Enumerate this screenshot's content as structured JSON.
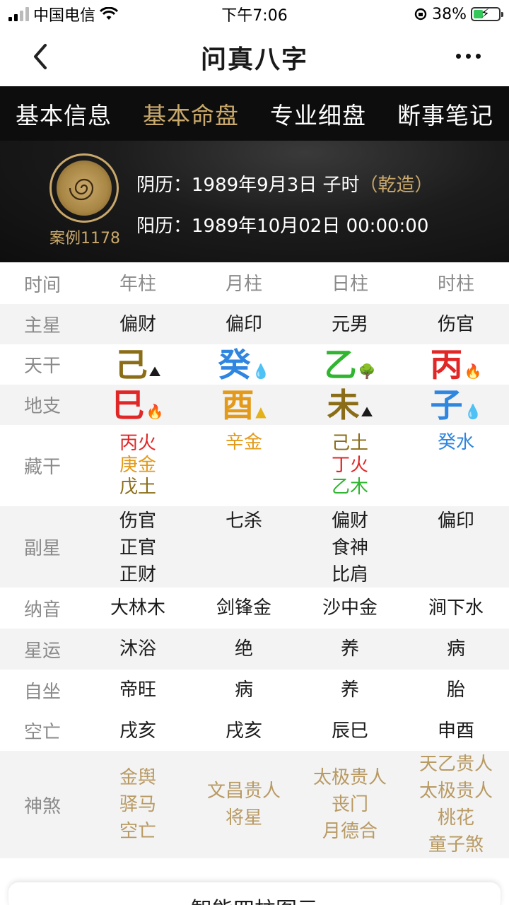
{
  "status": {
    "carrier": "中国电信",
    "time": "下午7:06",
    "battery": "38%",
    "battery_level": 0.38
  },
  "nav": {
    "title": "问真八字"
  },
  "tabs": [
    "基本信息",
    "基本命盘",
    "专业细盘",
    "断事笔记"
  ],
  "active_tab": 1,
  "profile": {
    "case": "案例1178",
    "lunar_label": "阴历：1989年9月3日 子时",
    "lunar_tag": "（乾造）",
    "solar_label": "阳历：1989年10月02日 00:00:00"
  },
  "table": {
    "header": [
      "时间",
      "年柱",
      "月柱",
      "日柱",
      "时柱"
    ],
    "zhuxing": {
      "label": "主星",
      "cells": [
        "偏财",
        "偏印",
        "元男",
        "伤官"
      ]
    },
    "tiangan": {
      "label": "天干",
      "chars": [
        "己",
        "癸",
        "乙",
        "丙"
      ],
      "colors": [
        "#8b6d17",
        "#2f86e0",
        "#2fb52f",
        "#e02626"
      ],
      "icons": [
        "earth-icon",
        "water-icon",
        "wood-icon",
        "fire-icon"
      ]
    },
    "dizhi": {
      "label": "地支",
      "chars": [
        "巳",
        "酉",
        "未",
        "子"
      ],
      "colors": [
        "#e02626",
        "#e39a1a",
        "#8b6d17",
        "#2f86e0"
      ],
      "icons": [
        "fire-icon",
        "metal-icon",
        "earth-icon",
        "water-icon"
      ]
    },
    "canggan": {
      "label": "藏干",
      "cells": [
        [
          {
            "t": "丙火",
            "c": "#e02626"
          },
          {
            "t": "庚金",
            "c": "#e39a1a"
          },
          {
            "t": "戊土",
            "c": "#8b6d17"
          }
        ],
        [
          {
            "t": "辛金",
            "c": "#e39a1a"
          }
        ],
        [
          {
            "t": "己土",
            "c": "#8b6d17"
          },
          {
            "t": "丁火",
            "c": "#e02626"
          },
          {
            "t": "乙木",
            "c": "#2fb52f"
          }
        ],
        [
          {
            "t": "癸水",
            "c": "#2f86e0"
          }
        ]
      ]
    },
    "fuxing": {
      "label": "副星",
      "cells": [
        [
          "伤官",
          "正官",
          "正财"
        ],
        [
          "七杀"
        ],
        [
          "偏财",
          "食神",
          "比肩"
        ],
        [
          "偏印"
        ]
      ]
    },
    "nayin": {
      "label": "纳音",
      "cells": [
        "大林木",
        "剑锋金",
        "沙中金",
        "涧下水"
      ]
    },
    "xingyun": {
      "label": "星运",
      "cells": [
        "沐浴",
        "绝",
        "养",
        "病"
      ]
    },
    "zizuo": {
      "label": "自坐",
      "cells": [
        "帝旺",
        "病",
        "养",
        "胎"
      ]
    },
    "kongwang": {
      "label": "空亡",
      "cells": [
        "戌亥",
        "戌亥",
        "辰巳",
        "申酉"
      ]
    },
    "shensha": {
      "label": "神煞",
      "cells": [
        [
          "金舆",
          "驿马",
          "空亡"
        ],
        [
          "文昌贵人",
          "将星"
        ],
        [
          "太极贵人",
          "丧门",
          "月德合"
        ],
        [
          "天乙贵人",
          "太极贵人",
          "桃花",
          "童子煞"
        ]
      ]
    }
  },
  "bottom_card": {
    "title": "智能四柱图示"
  }
}
